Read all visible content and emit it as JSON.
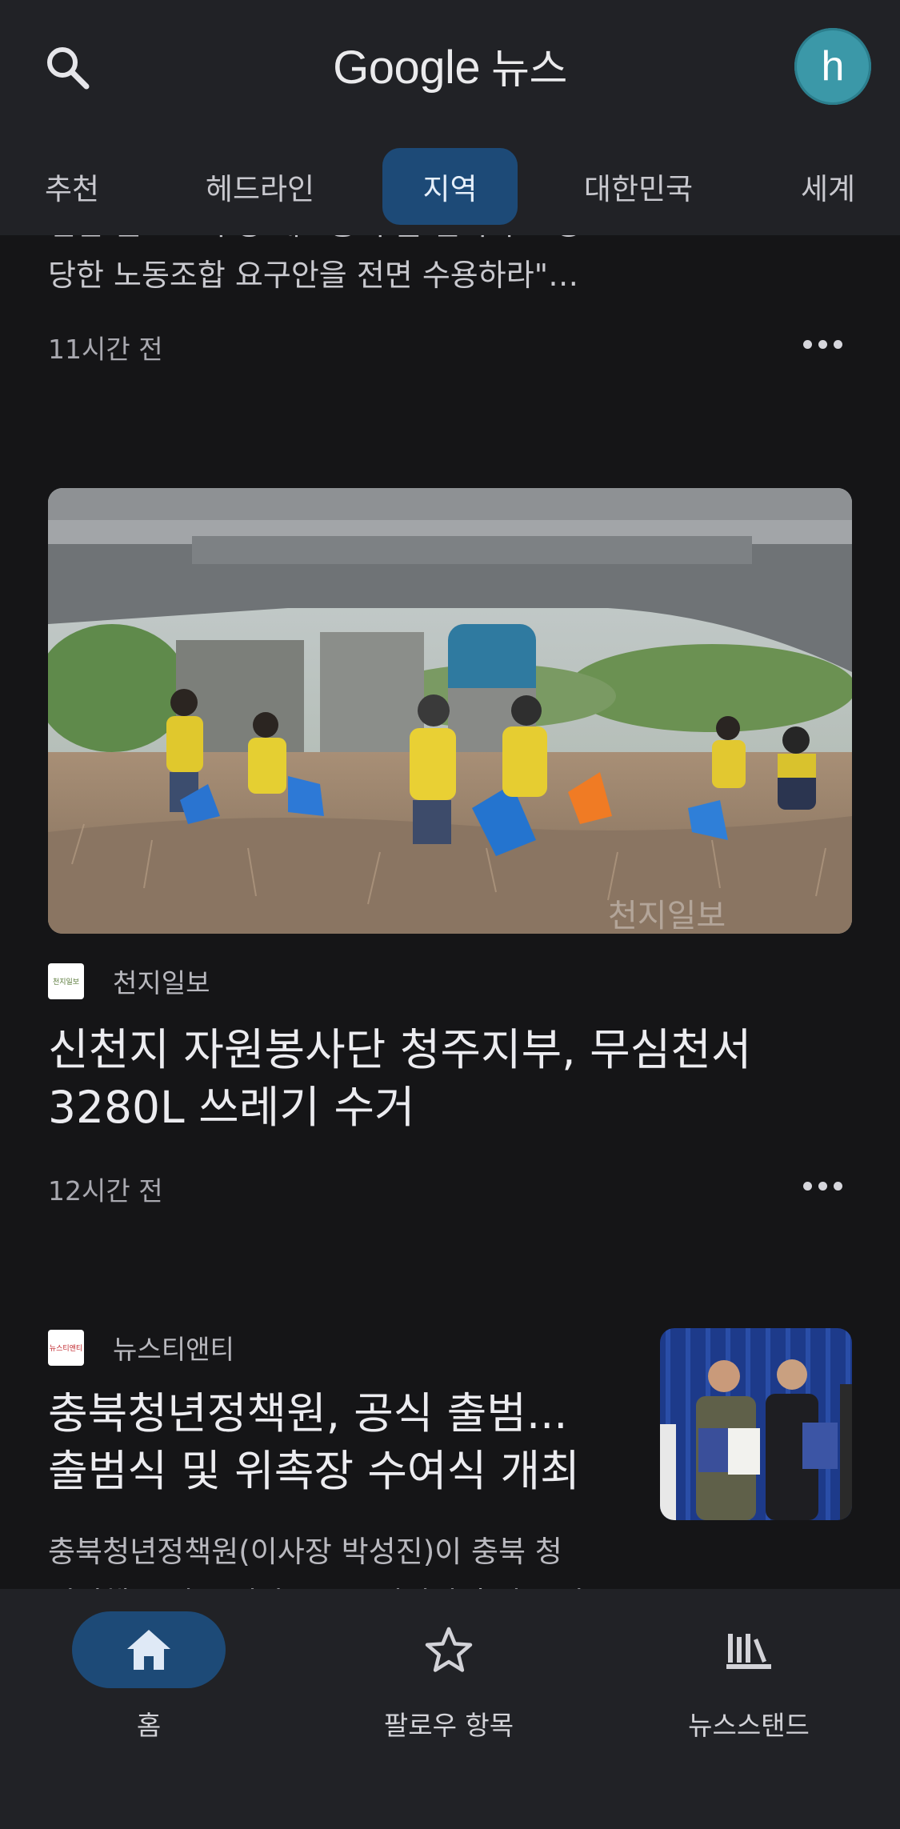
{
  "header": {
    "logo_word": "Google",
    "logo_suffix": "뉴스",
    "avatar_letter": "h",
    "tabs": [
      {
        "label": "추천"
      },
      {
        "label": "헤드라인"
      },
      {
        "label": "지역",
        "active": true
      },
      {
        "label": "대한민국"
      },
      {
        "label": "세계"
      }
    ]
  },
  "feed": {
    "prev_article": {
      "snippet_line1": "건한 권고\" \"부당 해고통 부를 철회하고 정",
      "snippet_line2": "당한 노동조합 요구안을 전면 수용하라\"…",
      "time": "11시간 전"
    },
    "featured_article": {
      "source_logo_text": "천지일보",
      "source": "천지일보",
      "headline_line1": "신천지 자원봉사단 청주지부, 무심천서",
      "headline_line2": "3280L 쓰레기 수거",
      "time": "12시간 전"
    },
    "third_article": {
      "source_logo_text": "뉴스티앤티",
      "source": "뉴스티앤티",
      "headline_line1": "충북청년정책원, 공식 출범...",
      "headline_line2": "출범식 및 위촉장 수여식 개최",
      "snippet_line1": "충북청년정책원(이사장 박성진)이 충북 청",
      "snippet_line2": "년정책을 이끌 기관으로 공식적인 출범을 알"
    }
  },
  "bottom_nav": {
    "items": [
      {
        "label": "홈",
        "icon": "home-icon",
        "active": true
      },
      {
        "label": "팔로우 항목",
        "icon": "star-icon"
      },
      {
        "label": "뉴스스탠드",
        "icon": "newsstand-icon"
      }
    ]
  },
  "colors": {
    "background": "#151517",
    "header": "#212226",
    "active_pill": "#1d4a77",
    "avatar": "#3b98a8"
  }
}
